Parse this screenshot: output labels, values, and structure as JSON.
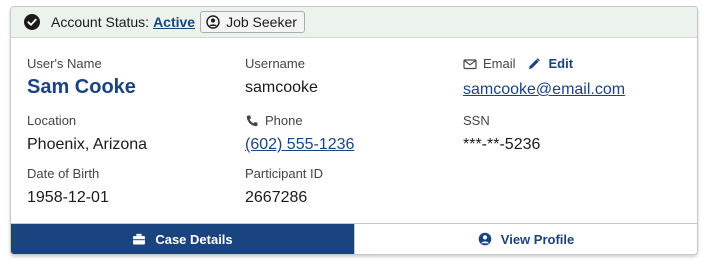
{
  "status_bar": {
    "label": "Account Status:",
    "status_link": "Active",
    "role_badge": "Job Seeker"
  },
  "fields": {
    "users_name": {
      "label": "User's Name",
      "value": "Sam Cooke"
    },
    "username": {
      "label": "Username",
      "value": "samcooke"
    },
    "email": {
      "label": "Email",
      "edit_label": "Edit",
      "value": "samcooke@email.com"
    },
    "location": {
      "label": "Location",
      "value": "Phoenix, Arizona"
    },
    "phone": {
      "label": "Phone",
      "value": "(602) 555-1236"
    },
    "ssn": {
      "label": "SSN",
      "value": "***-**-5236"
    },
    "dob": {
      "label": "Date of Birth",
      "value": "1958-12-01"
    },
    "participant_id": {
      "label": "Participant ID",
      "value": "2667286"
    }
  },
  "footer": {
    "case_details_label": "Case Details",
    "view_profile_label": "View Profile"
  },
  "icons": {
    "status": "check-circle-icon",
    "badge": "user-circle-icon",
    "email": "envelope-icon",
    "edit": "pencil-icon",
    "phone": "phone-icon",
    "case_details": "briefcase-icon",
    "view_profile": "user-circle-icon"
  },
  "colors": {
    "brand": "#1a4480",
    "status_bar_bg": "#ecf3ec"
  }
}
